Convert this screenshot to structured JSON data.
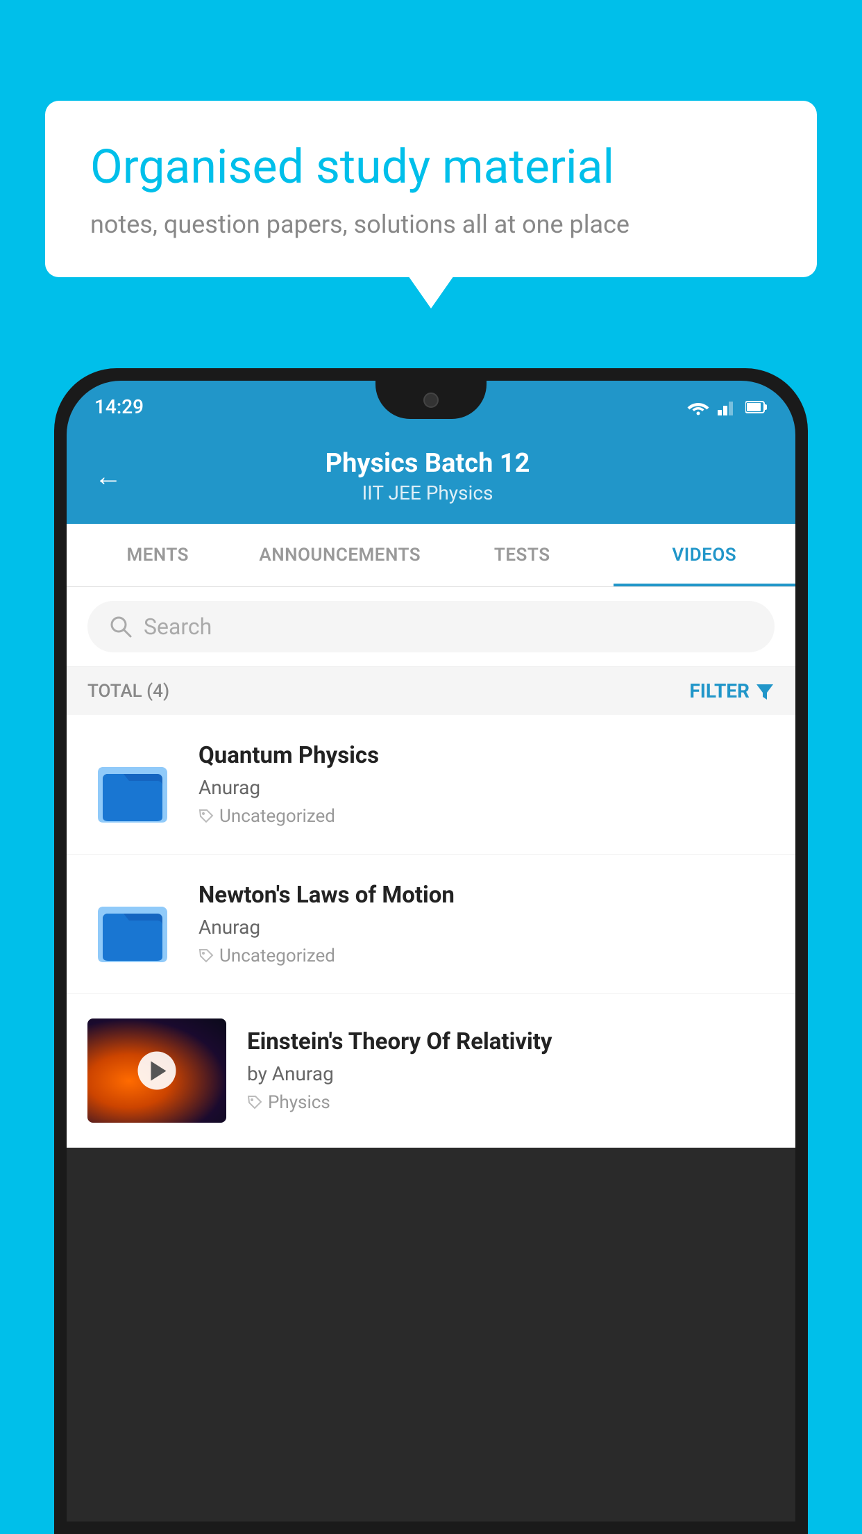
{
  "background": {
    "color": "#00BFEA"
  },
  "speech_bubble": {
    "title": "Organised study material",
    "subtitle": "notes, question papers, solutions all at one place"
  },
  "status_bar": {
    "time": "14:29"
  },
  "app_header": {
    "back_label": "←",
    "title": "Physics Batch 12",
    "subtitle": "IIT JEE   Physics"
  },
  "tabs": [
    {
      "label": "MENTS",
      "active": false
    },
    {
      "label": "ANNOUNCEMENTS",
      "active": false
    },
    {
      "label": "TESTS",
      "active": false
    },
    {
      "label": "VIDEOS",
      "active": true
    }
  ],
  "search": {
    "placeholder": "Search"
  },
  "filter": {
    "total_label": "TOTAL (4)",
    "filter_label": "FILTER"
  },
  "videos": [
    {
      "id": 1,
      "title": "Quantum Physics",
      "author": "Anurag",
      "tag": "Uncategorized",
      "type": "folder"
    },
    {
      "id": 2,
      "title": "Newton's Laws of Motion",
      "author": "Anurag",
      "tag": "Uncategorized",
      "type": "folder"
    },
    {
      "id": 3,
      "title": "Einstein's Theory Of Relativity",
      "author": "by Anurag",
      "tag": "Physics",
      "type": "video"
    }
  ]
}
